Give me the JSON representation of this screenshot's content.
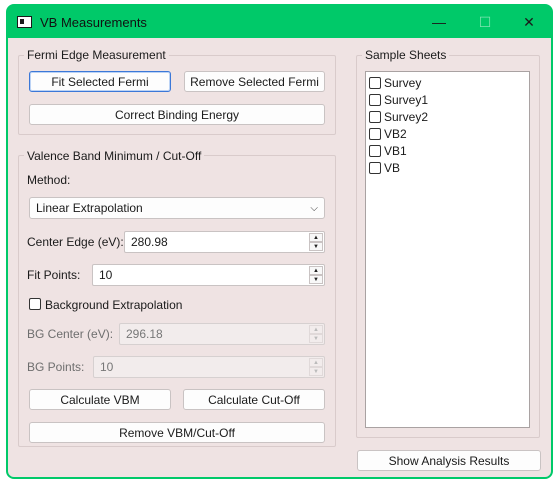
{
  "window": {
    "title": "VB Measurements",
    "icons": {
      "app": "app-window-icon",
      "minimize": "minimize-icon",
      "maximize": "maximize-icon",
      "close": "close-icon"
    },
    "minimize_glyph": "—",
    "maximize_glyph": "☐",
    "close_glyph": "✕"
  },
  "fermi": {
    "title": "Fermi Edge Measurement",
    "fit_label": "Fit Selected Fermi",
    "remove_label": "Remove Selected Fermi",
    "correct_label": "Correct Binding Energy"
  },
  "vbm": {
    "title": "Valence Band Minimum / Cut-Off",
    "method_label": "Method:",
    "method_value": "Linear Extrapolation",
    "center_edge_label": "Center Edge (eV):",
    "center_edge_value": "280.98",
    "fit_points_label": "Fit Points:",
    "fit_points_value": "10",
    "bg_extrap_label": "Background Extrapolation",
    "bg_extrap_checked": false,
    "bg_center_label": "BG Center (eV):",
    "bg_center_value": "296.18",
    "bg_points_label": "BG Points:",
    "bg_points_value": "10",
    "calc_vbm_label": "Calculate VBM",
    "calc_cutoff_label": "Calculate Cut-Off",
    "remove_label": "Remove VBM/Cut-Off"
  },
  "sheets": {
    "title": "Sample Sheets",
    "items": [
      {
        "label": "Survey",
        "checked": false
      },
      {
        "label": "Survey1",
        "checked": false
      },
      {
        "label": "Survey2",
        "checked": false
      },
      {
        "label": "VB2",
        "checked": false
      },
      {
        "label": "VB1",
        "checked": false
      },
      {
        "label": "VB",
        "checked": false
      }
    ]
  },
  "show_results_label": "Show Analysis Results"
}
